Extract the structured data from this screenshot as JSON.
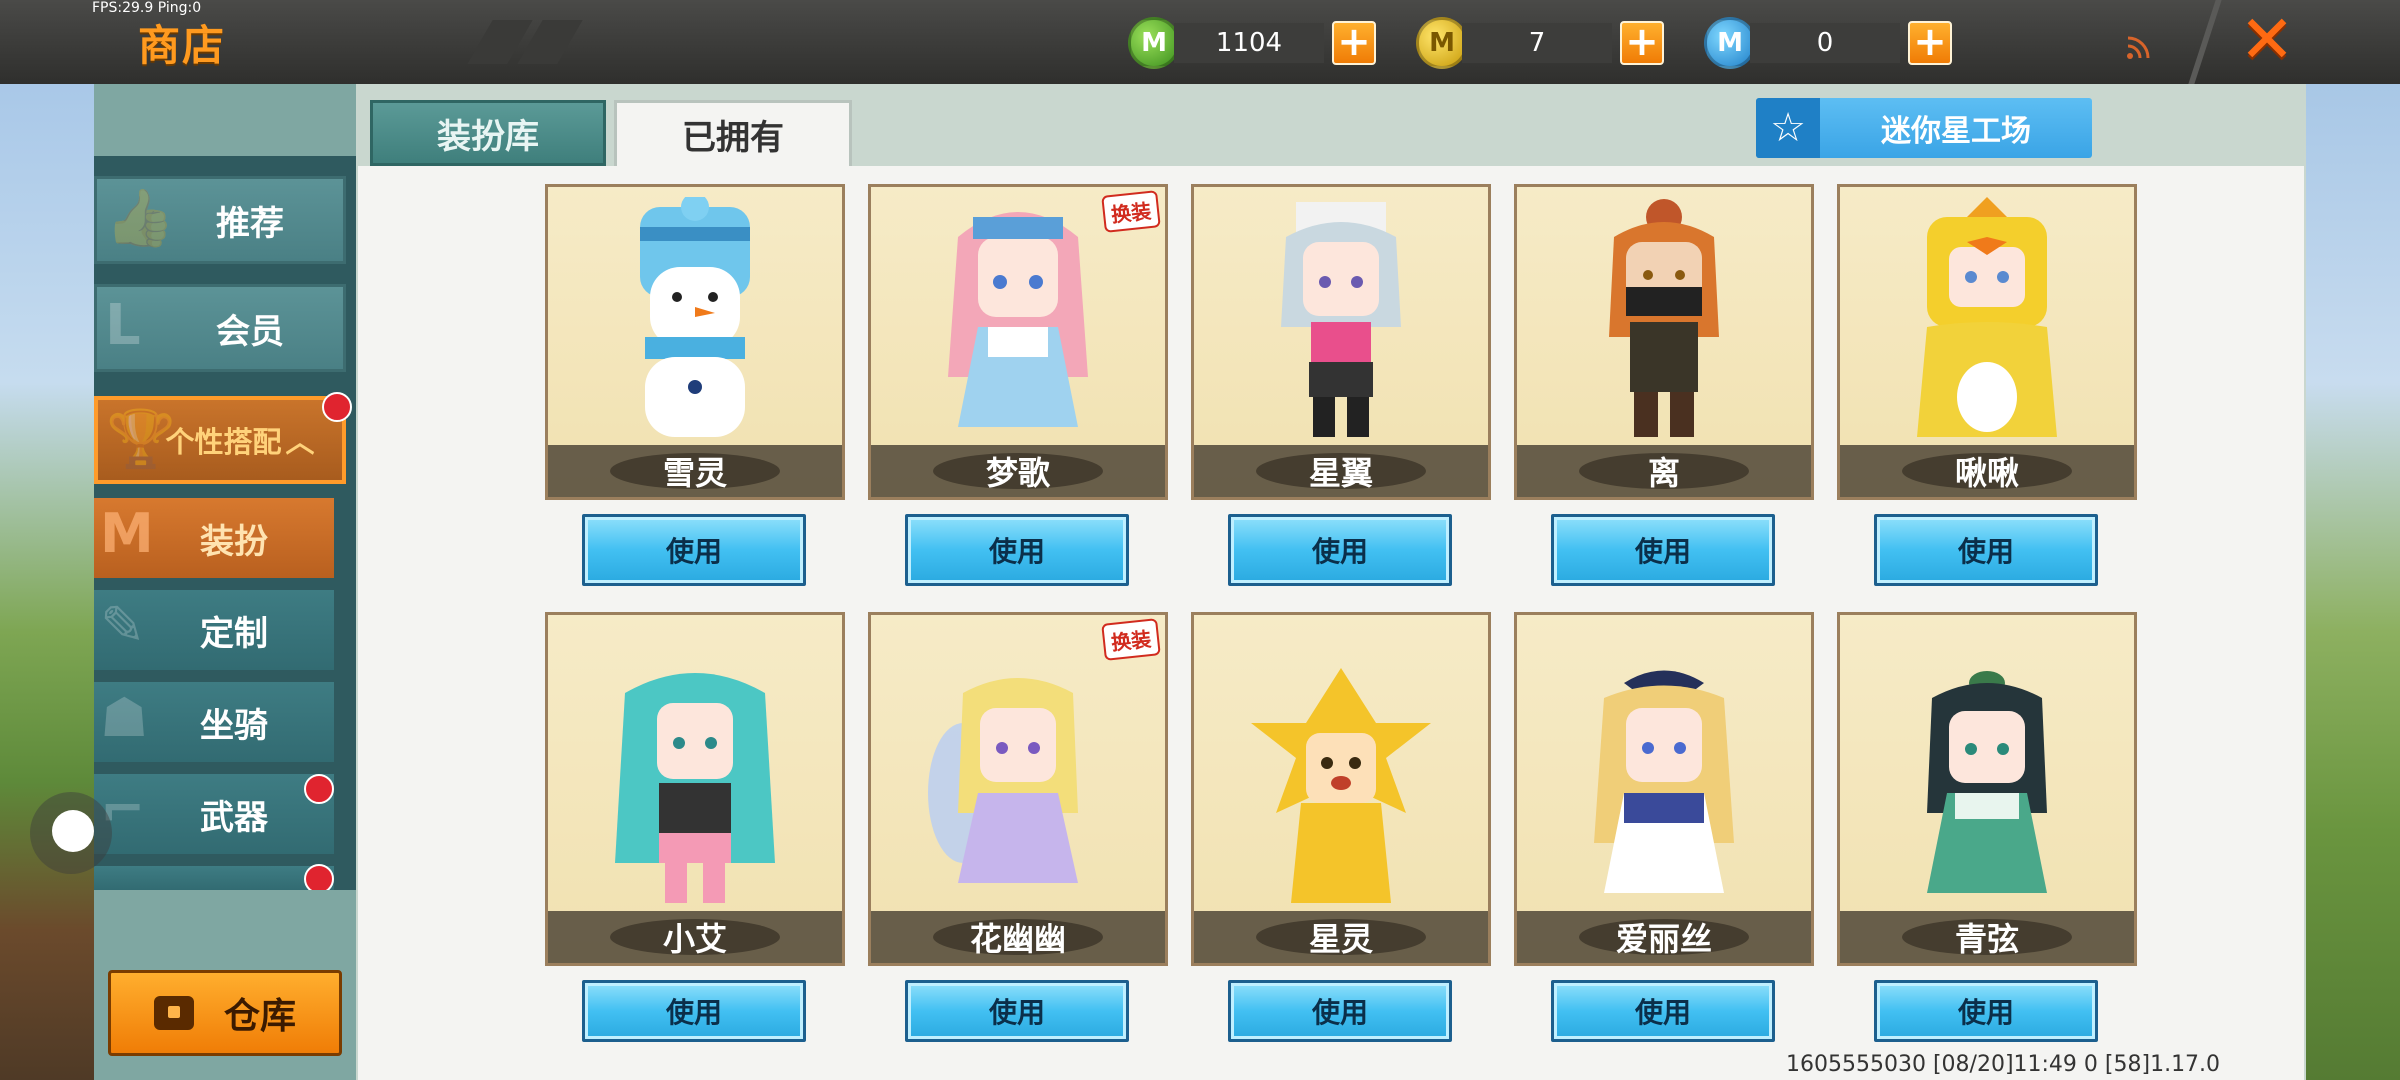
{
  "debug": {
    "fps_text": "FPS:29.9  Ping:0"
  },
  "header": {
    "title": "商店",
    "currencies": [
      {
        "name": "mini-beans",
        "icon": "green-coin-icon",
        "glyph": "M",
        "value": "1104"
      },
      {
        "name": "mini-coins",
        "icon": "gold-coin-icon",
        "glyph": "M",
        "value": "7"
      },
      {
        "name": "star-coins",
        "icon": "blue-coin-icon",
        "glyph": "M",
        "value": "0"
      }
    ],
    "plus_glyph": "+",
    "close_glyph": "✕"
  },
  "sidebar": {
    "items": [
      {
        "label": "推荐",
        "icon": "thumbs-up-icon",
        "ghost": "👍"
      },
      {
        "label": "会员",
        "icon": "member-l-icon",
        "ghost": "L"
      },
      {
        "label": "个性搭配",
        "icon": "trophy-icon",
        "ghost": "🏆",
        "suffix": "︿"
      },
      {
        "label": "装扮",
        "icon": "dress-m-icon",
        "ghost": "M"
      },
      {
        "label": "定制",
        "icon": "pencil-icon",
        "ghost": "✎"
      },
      {
        "label": "坐骑",
        "icon": "mount-icon",
        "ghost": "☗"
      },
      {
        "label": "武器",
        "icon": "gun-icon",
        "ghost": "⌐"
      }
    ],
    "warehouse_label": "仓库"
  },
  "tabs": {
    "dressing_label": "装扮库",
    "owned_label": "已拥有"
  },
  "workshop": {
    "label": "迷你星工场",
    "icon": "star-icon",
    "glyph": "☆"
  },
  "skins": [
    {
      "name": "雪灵",
      "button": "使用"
    },
    {
      "name": "梦歌",
      "button": "使用",
      "tag": "换装"
    },
    {
      "name": "星翼",
      "button": "使用"
    },
    {
      "name": "离",
      "button": "使用"
    },
    {
      "name": "啾啾",
      "button": "使用"
    },
    {
      "name": "小艾",
      "button": "使用"
    },
    {
      "name": "花幽幽",
      "button": "使用",
      "tag": "换装"
    },
    {
      "name": "星灵",
      "button": "使用"
    },
    {
      "name": "爱丽丝",
      "button": "使用"
    },
    {
      "name": "青弦",
      "button": "使用"
    }
  ],
  "footer": {
    "info": "1605555030  [08/20]11:49 0  [58]1.17.0"
  }
}
